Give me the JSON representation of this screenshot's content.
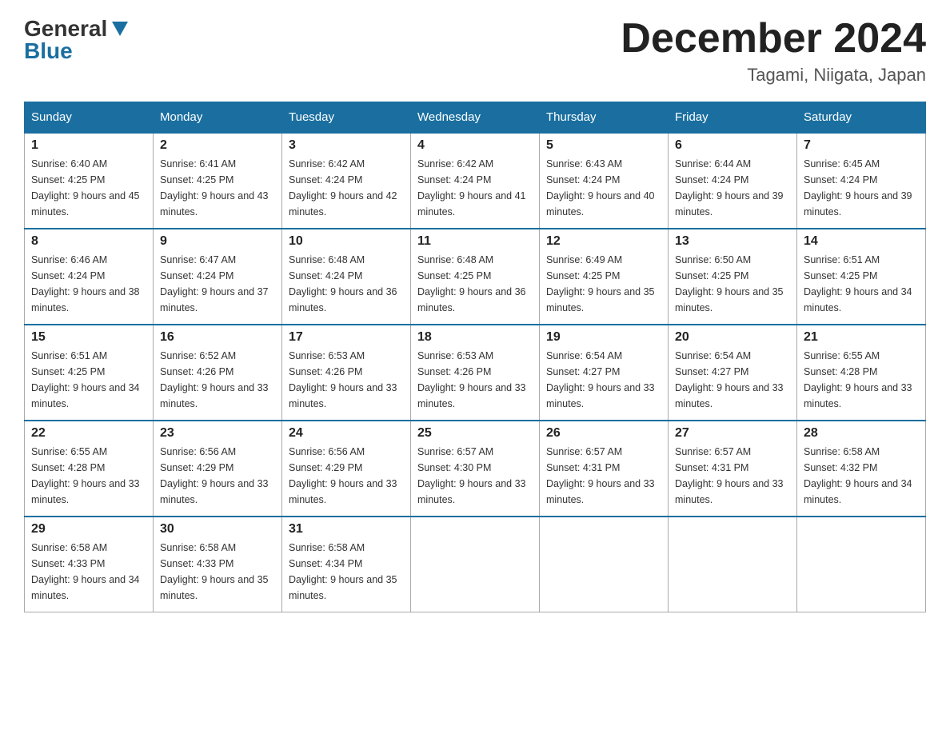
{
  "header": {
    "logo_general": "General",
    "logo_blue": "Blue",
    "month_title": "December 2024",
    "location": "Tagami, Niigata, Japan"
  },
  "weekdays": [
    "Sunday",
    "Monday",
    "Tuesday",
    "Wednesday",
    "Thursday",
    "Friday",
    "Saturday"
  ],
  "weeks": [
    [
      {
        "day": "1",
        "sunrise": "6:40 AM",
        "sunset": "4:25 PM",
        "daylight": "9 hours and 45 minutes."
      },
      {
        "day": "2",
        "sunrise": "6:41 AM",
        "sunset": "4:25 PM",
        "daylight": "9 hours and 43 minutes."
      },
      {
        "day": "3",
        "sunrise": "6:42 AM",
        "sunset": "4:24 PM",
        "daylight": "9 hours and 42 minutes."
      },
      {
        "day": "4",
        "sunrise": "6:42 AM",
        "sunset": "4:24 PM",
        "daylight": "9 hours and 41 minutes."
      },
      {
        "day": "5",
        "sunrise": "6:43 AM",
        "sunset": "4:24 PM",
        "daylight": "9 hours and 40 minutes."
      },
      {
        "day": "6",
        "sunrise": "6:44 AM",
        "sunset": "4:24 PM",
        "daylight": "9 hours and 39 minutes."
      },
      {
        "day": "7",
        "sunrise": "6:45 AM",
        "sunset": "4:24 PM",
        "daylight": "9 hours and 39 minutes."
      }
    ],
    [
      {
        "day": "8",
        "sunrise": "6:46 AM",
        "sunset": "4:24 PM",
        "daylight": "9 hours and 38 minutes."
      },
      {
        "day": "9",
        "sunrise": "6:47 AM",
        "sunset": "4:24 PM",
        "daylight": "9 hours and 37 minutes."
      },
      {
        "day": "10",
        "sunrise": "6:48 AM",
        "sunset": "4:24 PM",
        "daylight": "9 hours and 36 minutes."
      },
      {
        "day": "11",
        "sunrise": "6:48 AM",
        "sunset": "4:25 PM",
        "daylight": "9 hours and 36 minutes."
      },
      {
        "day": "12",
        "sunrise": "6:49 AM",
        "sunset": "4:25 PM",
        "daylight": "9 hours and 35 minutes."
      },
      {
        "day": "13",
        "sunrise": "6:50 AM",
        "sunset": "4:25 PM",
        "daylight": "9 hours and 35 minutes."
      },
      {
        "day": "14",
        "sunrise": "6:51 AM",
        "sunset": "4:25 PM",
        "daylight": "9 hours and 34 minutes."
      }
    ],
    [
      {
        "day": "15",
        "sunrise": "6:51 AM",
        "sunset": "4:25 PM",
        "daylight": "9 hours and 34 minutes."
      },
      {
        "day": "16",
        "sunrise": "6:52 AM",
        "sunset": "4:26 PM",
        "daylight": "9 hours and 33 minutes."
      },
      {
        "day": "17",
        "sunrise": "6:53 AM",
        "sunset": "4:26 PM",
        "daylight": "9 hours and 33 minutes."
      },
      {
        "day": "18",
        "sunrise": "6:53 AM",
        "sunset": "4:26 PM",
        "daylight": "9 hours and 33 minutes."
      },
      {
        "day": "19",
        "sunrise": "6:54 AM",
        "sunset": "4:27 PM",
        "daylight": "9 hours and 33 minutes."
      },
      {
        "day": "20",
        "sunrise": "6:54 AM",
        "sunset": "4:27 PM",
        "daylight": "9 hours and 33 minutes."
      },
      {
        "day": "21",
        "sunrise": "6:55 AM",
        "sunset": "4:28 PM",
        "daylight": "9 hours and 33 minutes."
      }
    ],
    [
      {
        "day": "22",
        "sunrise": "6:55 AM",
        "sunset": "4:28 PM",
        "daylight": "9 hours and 33 minutes."
      },
      {
        "day": "23",
        "sunrise": "6:56 AM",
        "sunset": "4:29 PM",
        "daylight": "9 hours and 33 minutes."
      },
      {
        "day": "24",
        "sunrise": "6:56 AM",
        "sunset": "4:29 PM",
        "daylight": "9 hours and 33 minutes."
      },
      {
        "day": "25",
        "sunrise": "6:57 AM",
        "sunset": "4:30 PM",
        "daylight": "9 hours and 33 minutes."
      },
      {
        "day": "26",
        "sunrise": "6:57 AM",
        "sunset": "4:31 PM",
        "daylight": "9 hours and 33 minutes."
      },
      {
        "day": "27",
        "sunrise": "6:57 AM",
        "sunset": "4:31 PM",
        "daylight": "9 hours and 33 minutes."
      },
      {
        "day": "28",
        "sunrise": "6:58 AM",
        "sunset": "4:32 PM",
        "daylight": "9 hours and 34 minutes."
      }
    ],
    [
      {
        "day": "29",
        "sunrise": "6:58 AM",
        "sunset": "4:33 PM",
        "daylight": "9 hours and 34 minutes."
      },
      {
        "day": "30",
        "sunrise": "6:58 AM",
        "sunset": "4:33 PM",
        "daylight": "9 hours and 35 minutes."
      },
      {
        "day": "31",
        "sunrise": "6:58 AM",
        "sunset": "4:34 PM",
        "daylight": "9 hours and 35 minutes."
      },
      null,
      null,
      null,
      null
    ]
  ]
}
